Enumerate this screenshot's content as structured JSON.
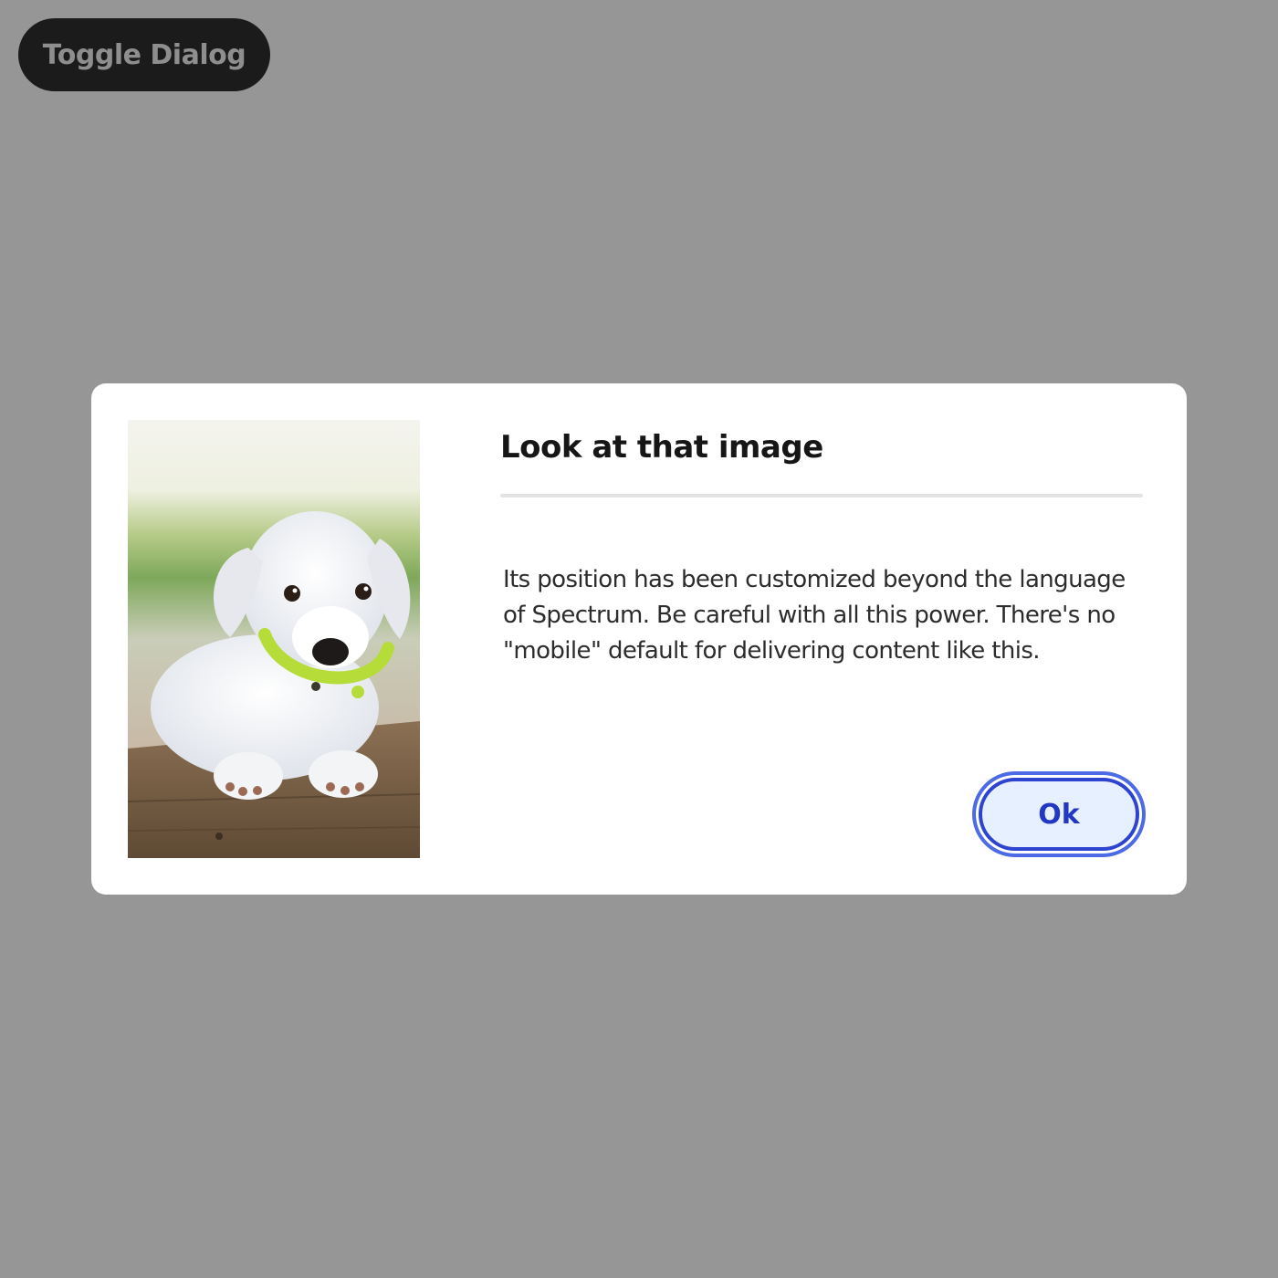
{
  "toggle_button": {
    "label": "Toggle Dialog"
  },
  "dialog": {
    "heading": "Look at that image",
    "content": "Its position has been customized beyond the language of Spectrum. Be careful with all this power. There's no \"mobile\" default for delivering content like this.",
    "ok_button": {
      "label": "Ok"
    }
  },
  "colors": {
    "backdrop": "#969696",
    "toggle_background": "#1b1b1b",
    "dialog_background": "#ffffff",
    "divider": "#e3e3e3",
    "ok_focus_ring": "#2c44cf",
    "ok_background": "#e6f0fe"
  }
}
